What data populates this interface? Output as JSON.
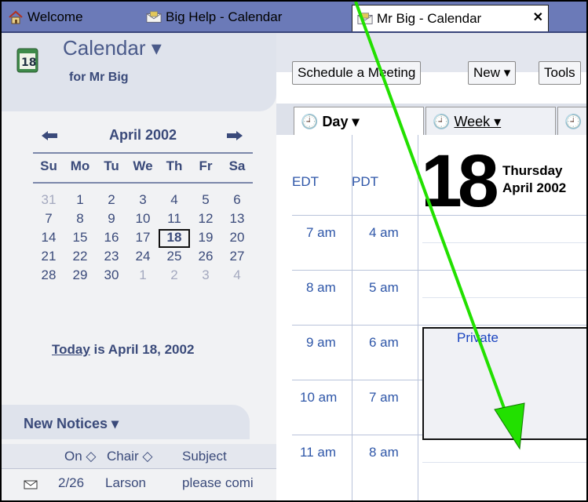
{
  "tabs": [
    {
      "label": "Welcome",
      "icon": "home-icon"
    },
    {
      "label": "Big Help - Calendar",
      "icon": "calendar-mail-icon"
    },
    {
      "label": "Mr Big - Calendar",
      "icon": "calendar-mail-icon",
      "active": true
    }
  ],
  "tab_close": "✕",
  "sidebar": {
    "title": "Calendar ▾",
    "subtitle": "for Mr Big",
    "mini_calendar": {
      "month": "April 2002",
      "days_of_week": [
        "Su",
        "Mo",
        "Tu",
        "We",
        "Th",
        "Fr",
        "Sa"
      ],
      "weeks": [
        [
          "31",
          "1",
          "2",
          "3",
          "4",
          "5",
          "6"
        ],
        [
          "7",
          "8",
          "9",
          "10",
          "11",
          "12",
          "13"
        ],
        [
          "14",
          "15",
          "16",
          "17",
          "18",
          "19",
          "20"
        ],
        [
          "21",
          "22",
          "23",
          "24",
          "25",
          "26",
          "27"
        ],
        [
          "28",
          "29",
          "30",
          "1",
          "2",
          "3",
          "4"
        ]
      ]
    },
    "today_link": "Today",
    "today_text": " is April 18, 2002"
  },
  "notices": {
    "title": "New Notices ▾",
    "columns": [
      "On ◇",
      "Chair ◇",
      "Subject"
    ],
    "rows": [
      {
        "date": "2/26",
        "chair": "Larson",
        "subject": "please comi"
      }
    ]
  },
  "toolbar": {
    "schedule": "Schedule a Meeting",
    "new": "New ▾",
    "tools": "Tools"
  },
  "views": {
    "day": "Day ▾",
    "week": "Week ▾"
  },
  "day_view": {
    "tz1": "EDT",
    "tz2": "PDT",
    "big_date": "18",
    "day_name": "Thursday",
    "month_year": "April 2002",
    "slots": [
      {
        "t1": "7 am",
        "t2": "4 am"
      },
      {
        "t1": "8 am",
        "t2": "5 am"
      },
      {
        "t1": "9 am",
        "t2": "6 am"
      },
      {
        "t1": "10 am",
        "t2": "7 am"
      },
      {
        "t1": "11 am",
        "t2": "8 am"
      }
    ],
    "event_label": "Private"
  },
  "colors": {
    "accent": "#3a4a7a",
    "link": "#2e56a8",
    "arrow": "#22e000"
  }
}
